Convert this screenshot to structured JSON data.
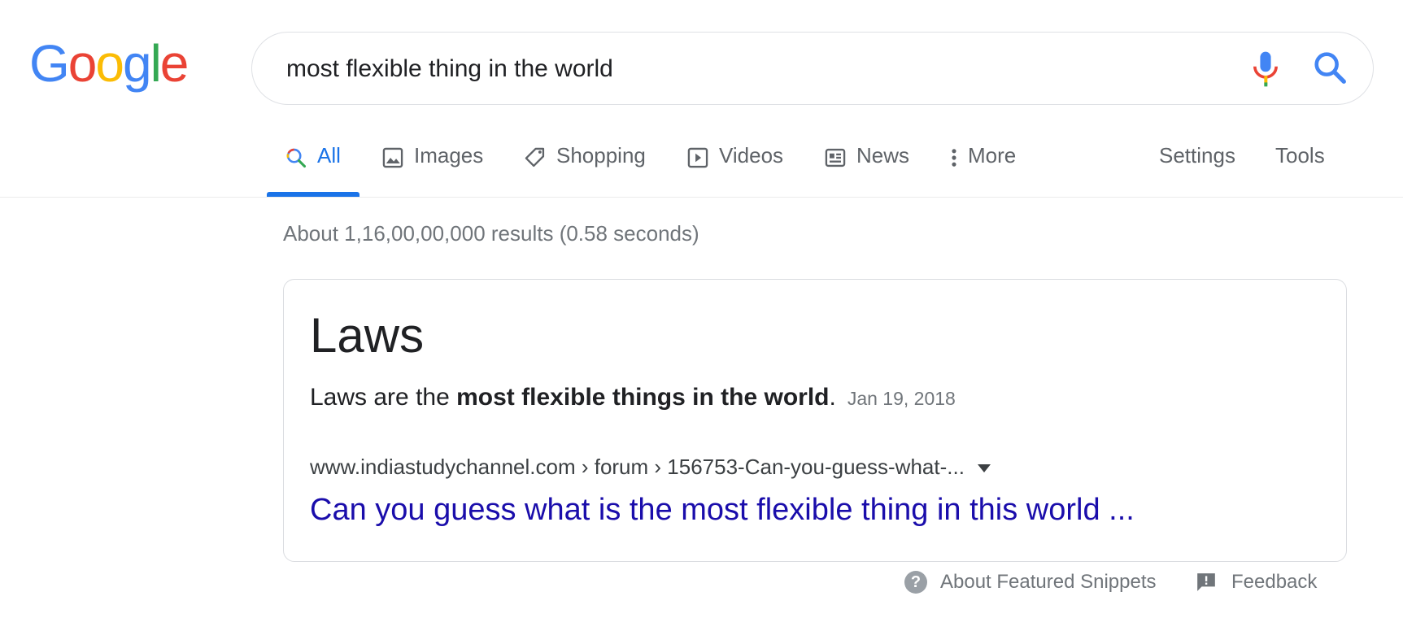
{
  "logo": {
    "letters": [
      "G",
      "o",
      "o",
      "g",
      "l",
      "e"
    ],
    "colors": [
      "#4285F4",
      "#EA4335",
      "#FBBC05",
      "#4285F4",
      "#34A853",
      "#EA4335"
    ]
  },
  "search": {
    "query": "most flexible thing in the world"
  },
  "tabs": [
    {
      "label": "All",
      "icon": "search-icon",
      "active": true
    },
    {
      "label": "Images",
      "icon": "image-icon"
    },
    {
      "label": "Shopping",
      "icon": "tag-icon"
    },
    {
      "label": "Videos",
      "icon": "play-icon"
    },
    {
      "label": "News",
      "icon": "news-icon"
    },
    {
      "label": "More",
      "icon": "more-vert-icon"
    }
  ],
  "tools": {
    "settings": "Settings",
    "tools": "Tools"
  },
  "stats": "About 1,16,00,00,000 results (0.58 seconds)",
  "featured": {
    "answer": "Laws",
    "snippet_pre": "Laws are the ",
    "snippet_bold": "most flexible things in the world",
    "snippet_post": ".",
    "date": "Jan 19, 2018",
    "cite": "www.indiastudychannel.com › forum › 156753-Can-you-guess-what-...",
    "title": "Can you guess what is the most flexible thing in this world ..."
  },
  "footer": {
    "about": "About Featured Snippets",
    "feedback": "Feedback"
  },
  "colors": {
    "link": "#1a0dab",
    "active_tab": "#1a73e8",
    "muted": "#70757a"
  }
}
